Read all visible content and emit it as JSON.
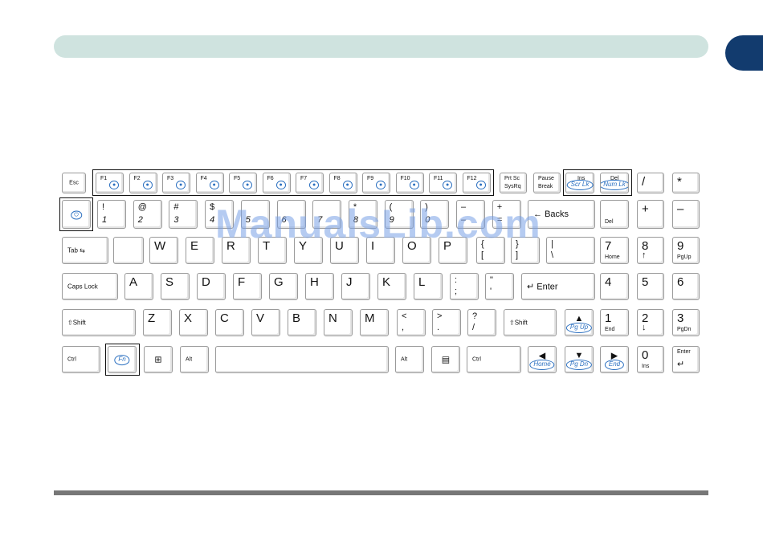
{
  "watermark": "ManualsLib.com",
  "colors": {
    "header_bar": "#cfe3df",
    "tab": "#123b6e",
    "icon_blue": "#2a6fc0"
  },
  "row1": {
    "esc": "Esc",
    "f": [
      "F1",
      "F2",
      "F3",
      "F4",
      "F5",
      "F6",
      "F7",
      "F8",
      "F9",
      "F10",
      "F11",
      "F12"
    ],
    "prtsc_top": "Prt Sc",
    "prtsc_bottom": "SysRq",
    "pause_top": "Pause",
    "pause_bottom": "Break",
    "ins_top": "Ins",
    "ins_icon": "Scr Lk",
    "del_top": "Del",
    "del_icon": "Num Lk",
    "slash": "/",
    "star": "*"
  },
  "row2": {
    "nums": [
      {
        "t": "!",
        "b": "1"
      },
      {
        "t": "@",
        "b": "2"
      },
      {
        "t": "#",
        "b": "3"
      },
      {
        "t": "$",
        "b": "4"
      },
      {
        "t": "",
        "b": "5"
      },
      {
        "t": "",
        "b": "6"
      },
      {
        "t": "",
        "b": "7"
      },
      {
        "t": "*",
        "b": "8"
      },
      {
        "t": "(",
        "b": "9"
      },
      {
        "t": ")",
        "b": "0"
      },
      {
        "t": "–",
        "b": "–"
      },
      {
        "t": "+",
        "b": "="
      }
    ],
    "backspace": "Backs",
    "del": "Del",
    "np_plus": "+",
    "np_minus": "–"
  },
  "row3": {
    "tab": "Tab",
    "letters": [
      "W",
      "E",
      "R",
      "T",
      "Y",
      "U",
      "I",
      "O",
      "P"
    ],
    "lbrace_t": "{",
    "lbrace_b": "[",
    "rbrace_t": "}",
    "rbrace_b": "]",
    "pipe_t": "|",
    "pipe_b": "\\",
    "np7": "7",
    "np7b": "Home",
    "np8": "8",
    "np8b": "↑",
    "np9": "9",
    "np9b": "PgUp"
  },
  "row4": {
    "caps": "Caps Lock",
    "letters": [
      "A",
      "S",
      "D",
      "F",
      "G",
      "H",
      "J",
      "K",
      "L"
    ],
    "semi_t": ":",
    "semi_b": ";",
    "quote_t": "\"",
    "quote_b": "'",
    "enter": "Enter",
    "np4": "4",
    "np5": "5",
    "np6": "6"
  },
  "row5": {
    "shift": "Shift",
    "letters": [
      "Z",
      "X",
      "C",
      "V",
      "B",
      "N",
      "M"
    ],
    "lt_t": "<",
    "lt_b": ",",
    "gt_t": ">",
    "gt_b": ".",
    "q_t": "?",
    "q_b": "/",
    "shift_r": "Shift",
    "up_icon": "Pg Up",
    "np1": "1",
    "np1b": "End",
    "np2": "2",
    "np2b": "↓",
    "np3": "3",
    "np3b": "PgDn"
  },
  "row6": {
    "ctrl": "Ctrl",
    "fn": "Fn",
    "alt": "Alt",
    "alt_r": "Alt",
    "ctrl_r": "Ctrl",
    "home_icon": "Home",
    "pgdn_icon": "Pg Dn",
    "end_icon": "End",
    "np0": "0",
    "np0b": "Ins",
    "npenter": "Enter"
  }
}
